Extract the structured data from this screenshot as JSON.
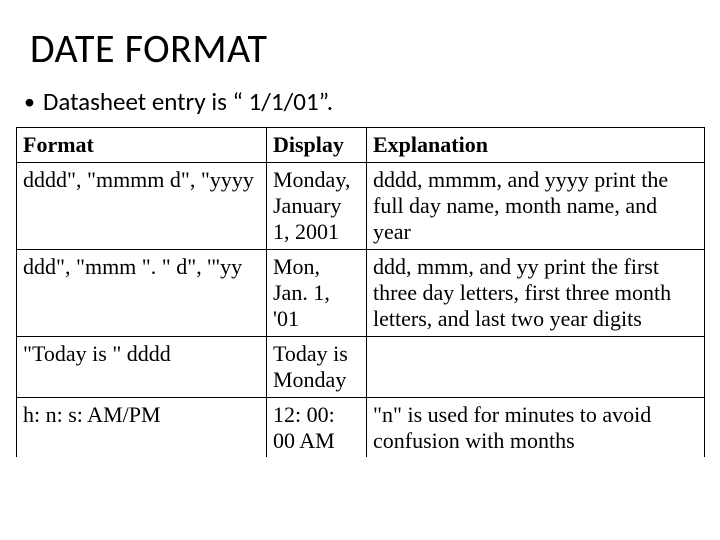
{
  "title": "DATE FORMAT",
  "bullet": "Datasheet entry is “ 1/1/01”.",
  "table": {
    "headers": {
      "format": "Format",
      "display": "Display",
      "explanation": "Explanation"
    },
    "rows": [
      {
        "format": "dddd\", \"mmmm d\", \"yyyy",
        "display": "Monday, January 1, 2001",
        "explanation": "dddd, mmmm, and yyyy print the full day name, month name, and year"
      },
      {
        "format": "ddd\", \"mmm \". \" d\", '\"yy",
        "display": "Mon, Jan. 1, '01",
        "explanation": "ddd, mmm, and yy print the first three day letters, first three month letters, and last two year digits"
      },
      {
        "format": "\"Today is \" dddd",
        "display": "Today is Monday",
        "explanation": ""
      },
      {
        "format": "h: n: s: AM/PM",
        "display": "12: 00: 00 AM",
        "explanation": "\"n\" is used for minutes to avoid confusion with months"
      }
    ]
  }
}
